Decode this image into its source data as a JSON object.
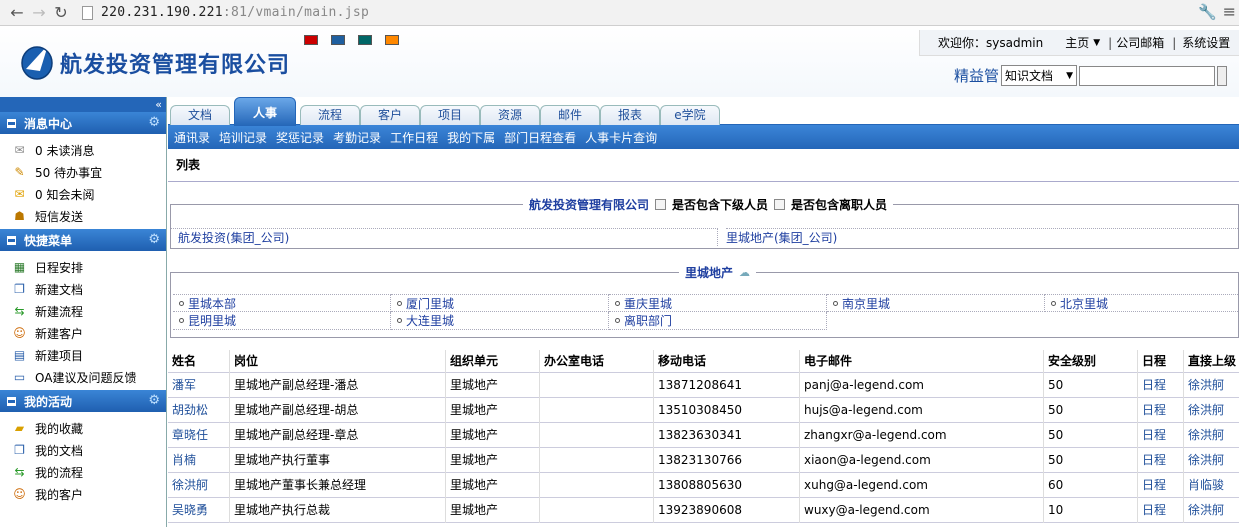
{
  "browser": {
    "url_host": "220.231.190.221",
    "url_rest": ":81/vmain/main.jsp"
  },
  "header": {
    "company": "航发投资管理有限公司",
    "swatches": [
      "#cc0000",
      "#1f5f9f",
      "#006666",
      "#ff8800"
    ],
    "welcome": "欢迎你：sysadmin",
    "home": "主页",
    "mail": "公司邮箱",
    "settings": "系统设置",
    "search_label": "精益管",
    "search_select": "知识文档"
  },
  "sidebar": {
    "collapse": "«",
    "sections": [
      {
        "title": "消息中心",
        "items": [
          "0 未读消息",
          "50 待办事宜",
          "0 知会未阅",
          "短信发送"
        ]
      },
      {
        "title": "快捷菜单",
        "items": [
          "日程安排",
          "新建文档",
          "新建流程",
          "新建客户",
          "新建项目",
          "OA建议及问题反馈"
        ]
      },
      {
        "title": "我的活动",
        "items": [
          "我的收藏",
          "我的文档",
          "我的流程",
          "我的客户"
        ]
      }
    ]
  },
  "tabs": [
    "文档",
    "人事",
    "流程",
    "客户",
    "项目",
    "资源",
    "邮件",
    "报表",
    "e学院"
  ],
  "subnav": [
    "通讯录",
    "培训记录",
    "奖惩记录",
    "考勤记录",
    "工作日程",
    "我的下属",
    "部门日程查看",
    "人事卡片查询"
  ],
  "list_title": "列表",
  "org": {
    "company": "航发投资管理有限公司",
    "opt1": "是否包含下级人员",
    "opt2": "是否包含离职人员",
    "groups": [
      "航发投资(集团_公司)",
      "里城地产(集团_公司)"
    ]
  },
  "dept": {
    "title": "里城地产",
    "items": [
      "里城本部",
      "厦门里城",
      "重庆里城",
      "南京里城",
      "北京里城",
      "昆明里城",
      "大连里城",
      "离职部门"
    ]
  },
  "table": {
    "headers": [
      "姓名",
      "岗位",
      "组织单元",
      "办公室电话",
      "移动电话",
      "电子邮件",
      "安全级别",
      "日程",
      "直接上级"
    ],
    "rows": [
      [
        "潘军",
        "里城地产副总经理-潘总",
        "里城地产",
        "",
        "13871208641",
        "panj@a-legend.com",
        "50",
        "日程",
        "徐洪舸"
      ],
      [
        "胡劲松",
        "里城地产副总经理-胡总",
        "里城地产",
        "",
        "13510308450",
        "hujs@a-legend.com",
        "50",
        "日程",
        "徐洪舸"
      ],
      [
        "章晓任",
        "里城地产副总经理-章总",
        "里城地产",
        "",
        "13823630341",
        "zhangxr@a-legend.com",
        "50",
        "日程",
        "徐洪舸"
      ],
      [
        "肖楠",
        "里城地产执行董事",
        "里城地产",
        "",
        "13823130766",
        "xiaon@a-legend.com",
        "50",
        "日程",
        "徐洪舸"
      ],
      [
        "徐洪舸",
        "里城地产董事长兼总经理",
        "里城地产",
        "",
        "13808805630",
        "xuhg@a-legend.com",
        "60",
        "日程",
        "肖临骏"
      ],
      [
        "吴晓勇",
        "里城地产执行总裁",
        "里城地产",
        "",
        "13923890608",
        "wuxy@a-legend.com",
        "10",
        "日程",
        "徐洪舸"
      ]
    ]
  }
}
